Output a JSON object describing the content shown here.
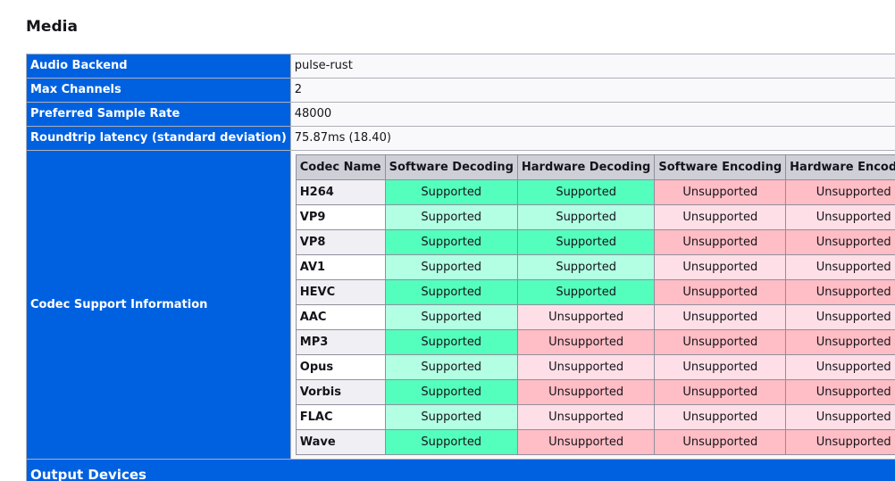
{
  "section_title": "Media",
  "rows": [
    {
      "label": "Audio Backend",
      "value": "pulse-rust"
    },
    {
      "label": "Max Channels",
      "value": "2"
    },
    {
      "label": "Preferred Sample Rate",
      "value": "48000"
    },
    {
      "label": "Roundtrip latency (standard deviation)",
      "value": "75.87ms (18.40)"
    }
  ],
  "codec_support": {
    "label": "Codec Support Information",
    "headers": [
      "Codec Name",
      "Software Decoding",
      "Hardware Decoding",
      "Software Encoding",
      "Hardware Encoding"
    ],
    "codecs": [
      {
        "name": "H264",
        "sd": "Supported",
        "hd": "Supported",
        "se": "Unsupported",
        "he": "Unsupported"
      },
      {
        "name": "VP9",
        "sd": "Supported",
        "hd": "Supported",
        "se": "Unsupported",
        "he": "Unsupported"
      },
      {
        "name": "VP8",
        "sd": "Supported",
        "hd": "Supported",
        "se": "Unsupported",
        "he": "Unsupported"
      },
      {
        "name": "AV1",
        "sd": "Supported",
        "hd": "Supported",
        "se": "Unsupported",
        "he": "Unsupported"
      },
      {
        "name": "HEVC",
        "sd": "Supported",
        "hd": "Supported",
        "se": "Unsupported",
        "he": "Unsupported"
      },
      {
        "name": "AAC",
        "sd": "Supported",
        "hd": "Unsupported",
        "se": "Unsupported",
        "he": "Unsupported"
      },
      {
        "name": "MP3",
        "sd": "Supported",
        "hd": "Unsupported",
        "se": "Unsupported",
        "he": "Unsupported"
      },
      {
        "name": "Opus",
        "sd": "Supported",
        "hd": "Unsupported",
        "se": "Unsupported",
        "he": "Unsupported"
      },
      {
        "name": "Vorbis",
        "sd": "Supported",
        "hd": "Unsupported",
        "se": "Unsupported",
        "he": "Unsupported"
      },
      {
        "name": "FLAC",
        "sd": "Supported",
        "hd": "Unsupported",
        "se": "Unsupported",
        "he": "Unsupported"
      },
      {
        "name": "Wave",
        "sd": "Supported",
        "hd": "Unsupported",
        "se": "Unsupported",
        "he": "Unsupported"
      }
    ]
  },
  "output_devices_label": "Output Devices",
  "colors": {
    "header_blue": "#0061e0",
    "supported_strong": "#54ffbd",
    "supported_light": "#b3ffe3",
    "unsupported_strong": "#ffbdc5",
    "unsupported_light": "#ffdfe7"
  }
}
